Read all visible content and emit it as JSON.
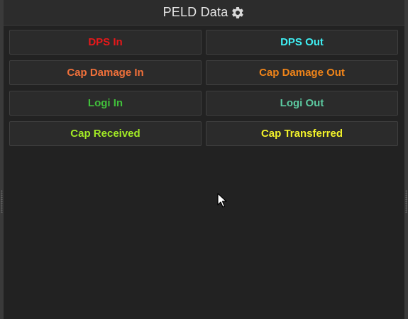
{
  "window": {
    "title": "PELD Data",
    "settings_icon": "gear-icon"
  },
  "buttons": [
    {
      "label": "DPS In",
      "color": "#e8181a"
    },
    {
      "label": "DPS Out",
      "color": "#3ff0f4"
    },
    {
      "label": "Cap Damage In",
      "color": "#f0703a"
    },
    {
      "label": "Cap Damage Out",
      "color": "#f08419"
    },
    {
      "label": "Logi In",
      "color": "#41c03b"
    },
    {
      "label": "Logi Out",
      "color": "#5cc9a0"
    },
    {
      "label": "Cap Received",
      "color": "#a2ea25"
    },
    {
      "label": "Cap Transferred",
      "color": "#f1f12a"
    }
  ]
}
